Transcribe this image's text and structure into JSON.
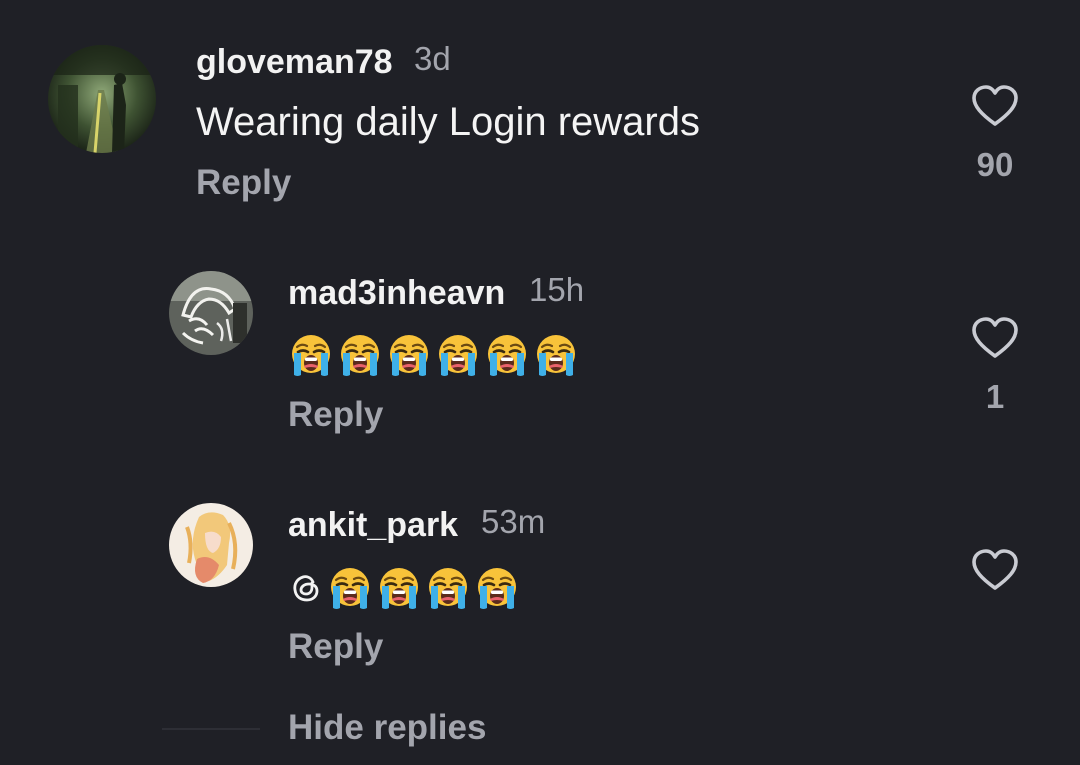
{
  "comments": [
    {
      "username": "gloveman78",
      "time": "3d",
      "text": "Wearing daily Login rewards",
      "reply_label": "Reply",
      "likes": "90",
      "avatar_icon": "train-tunnel-avatar"
    },
    {
      "username": "mad3inheavn",
      "time": "15h",
      "emojis": [
        "loudly-crying-face",
        "loudly-crying-face",
        "loudly-crying-face",
        "loudly-crying-face",
        "loudly-crying-face",
        "loudly-crying-face"
      ],
      "reply_label": "Reply",
      "likes": "1",
      "avatar_icon": "sketch-avatar"
    },
    {
      "username": "ankit_park",
      "time": "53m",
      "prefix_icon": "threads-icon",
      "emojis": [
        "loudly-crying-face",
        "loudly-crying-face",
        "loudly-crying-face",
        "loudly-crying-face"
      ],
      "reply_label": "Reply",
      "likes": "",
      "avatar_icon": "anime-avatar"
    }
  ],
  "hide_replies_label": "Hide replies",
  "colors": {
    "background": "#1f2026",
    "primary_text": "#f2f2f2",
    "secondary_text": "#a3a5ad",
    "heart_outline": "#c9cbd2"
  }
}
